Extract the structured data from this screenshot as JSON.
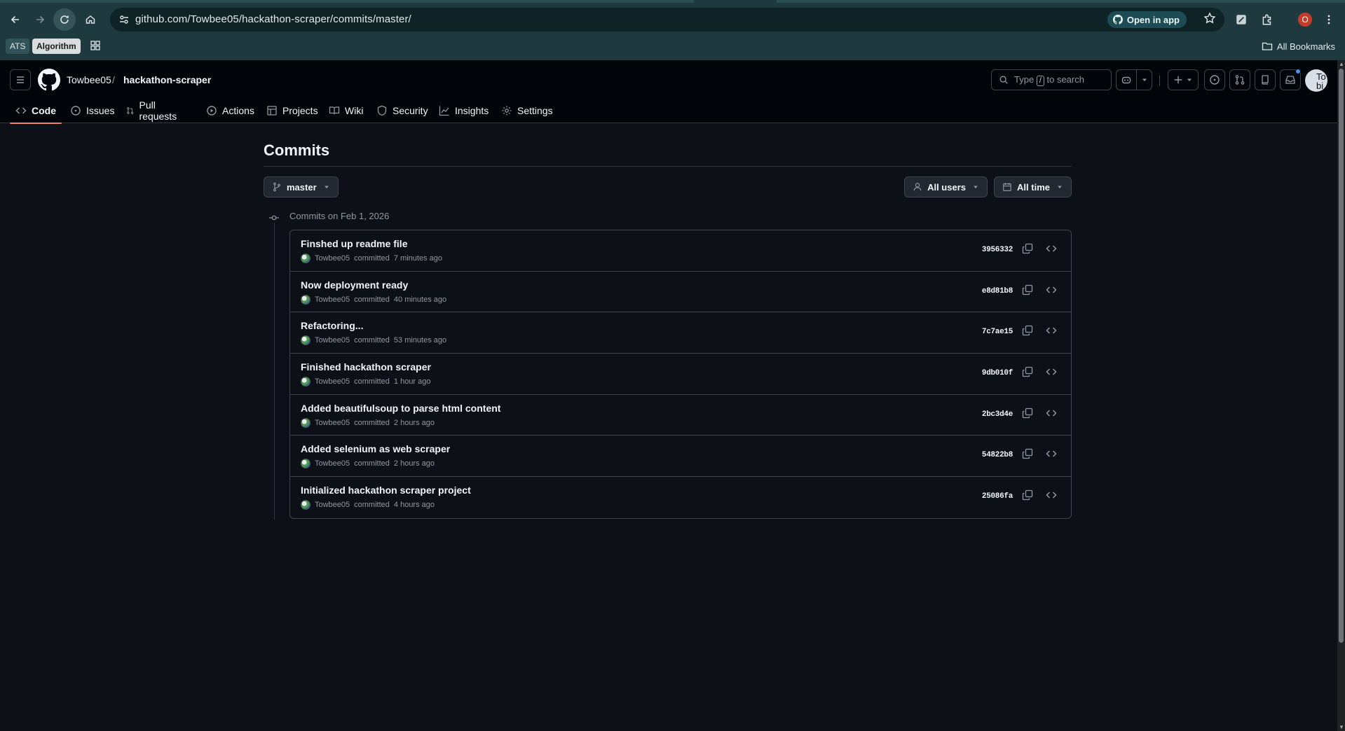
{
  "browser": {
    "url": "github.com/Towbee05/hackathon-scraper/commits/master/",
    "open_in_app": "Open in app",
    "profile_initial": "O",
    "bookmarks": [
      "ATS",
      "Algorithm"
    ],
    "all_bookmarks": "All Bookmarks"
  },
  "header": {
    "owner": "Towbee05",
    "separator": "/",
    "repo": "hackathon-scraper",
    "search_prefix": "Type",
    "search_key": "/",
    "search_suffix": "to search",
    "avatar_text": "To bi"
  },
  "tabs": [
    {
      "label": "Code",
      "icon": "code-icon",
      "selected": true
    },
    {
      "label": "Issues",
      "icon": "issue-icon"
    },
    {
      "label": "Pull requests",
      "icon": "pull-request-icon"
    },
    {
      "label": "Actions",
      "icon": "play-icon"
    },
    {
      "label": "Projects",
      "icon": "table-icon"
    },
    {
      "label": "Wiki",
      "icon": "book-icon"
    },
    {
      "label": "Security",
      "icon": "shield-icon"
    },
    {
      "label": "Insights",
      "icon": "graph-icon"
    },
    {
      "label": "Settings",
      "icon": "gear-icon"
    }
  ],
  "main": {
    "title": "Commits",
    "branch": "master",
    "users_filter": "All users",
    "time_filter": "All time",
    "group_date": "Commits on Feb 1, 2026",
    "commits": [
      {
        "message": "Finshed up readme file",
        "author": "Towbee05",
        "verb": "committed",
        "time": "7 minutes ago",
        "sha": "3956332"
      },
      {
        "message": "Now deployment ready",
        "author": "Towbee05",
        "verb": "committed",
        "time": "40 minutes ago",
        "sha": "e8d81b8"
      },
      {
        "message": "Refactoring...",
        "author": "Towbee05",
        "verb": "committed",
        "time": "53 minutes ago",
        "sha": "7c7ae15"
      },
      {
        "message": "Finished hackathon scraper",
        "author": "Towbee05",
        "verb": "committed",
        "time": "1 hour ago",
        "sha": "9db010f"
      },
      {
        "message": "Added beautifulsoup to parse html content",
        "author": "Towbee05",
        "verb": "committed",
        "time": "2 hours ago",
        "sha": "2bc3d4e"
      },
      {
        "message": "Added selenium as web scraper",
        "author": "Towbee05",
        "verb": "committed",
        "time": "2 hours ago",
        "sha": "54822b8"
      },
      {
        "message": "Initialized hackathon scraper project",
        "author": "Towbee05",
        "verb": "committed",
        "time": "4 hours ago",
        "sha": "25086fa"
      }
    ]
  }
}
